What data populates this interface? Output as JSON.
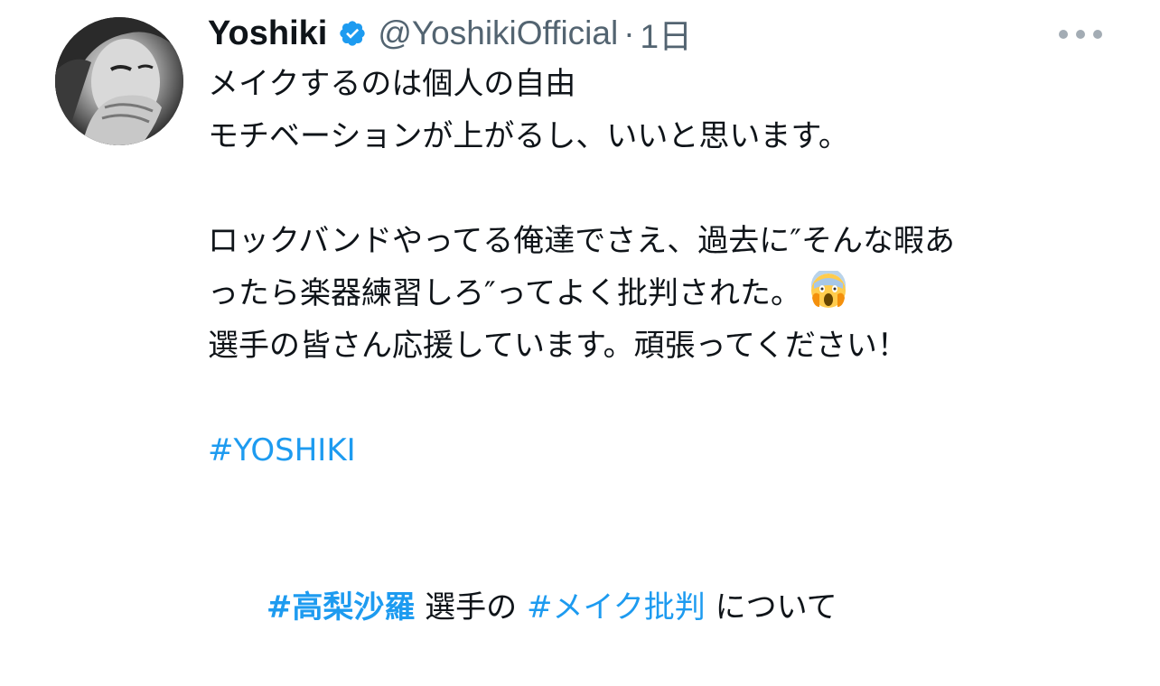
{
  "tweet": {
    "author": {
      "display_name": "Yoshiki",
      "handle": "@YoshikiOfficial",
      "separator": "·",
      "time": "1日",
      "verified": true,
      "avatar_icon": "profile-avatar"
    },
    "more_icon": "more-horizontal-icon",
    "text": {
      "line1": "メイクするのは個人の自由",
      "line2": "モチベーションが上がるし、いいと思います。",
      "line3": "ロックバンドやってる俺達でさえ、過去に″そんな暇あ",
      "line4": "ったら楽器練習しろ″ってよく批判された。",
      "line4_emoji": "face-screaming-in-fear-emoji",
      "line5": "選手の皆さん応援しています。頑張ってください！",
      "hashtag1": "#YOSHIKI",
      "hashtag2": "#高梨沙羅",
      "line7_mid": " 選手の ",
      "hashtag3": "#メイク批判",
      "line7_end": " について"
    },
    "colors": {
      "text": "#0f1419",
      "secondary": "#536471",
      "link": "#1d9bf0",
      "verified": "#1d9bf0"
    }
  }
}
